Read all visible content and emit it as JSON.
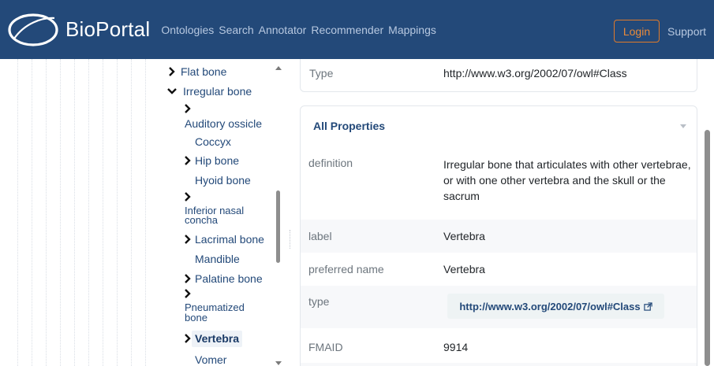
{
  "app": {
    "name": "BioPortal"
  },
  "nav": {
    "links": [
      "Ontologies",
      "Search",
      "Annotator",
      "Recommender",
      "Mappings"
    ],
    "login_label": "Login",
    "support_label": "Support"
  },
  "tree": {
    "nodes": [
      {
        "label": "Flat bone",
        "expandable": true,
        "expanded": false
      },
      {
        "label": "Irregular bone",
        "expandable": true,
        "expanded": true
      },
      {
        "label": "Auditory ossicle",
        "expandable": true,
        "expanded": false
      },
      {
        "label": "Coccyx",
        "expandable": false
      },
      {
        "label": "Hip bone",
        "expandable": true,
        "expanded": false
      },
      {
        "label": "Hyoid bone",
        "expandable": false
      },
      {
        "label": "Inferior nasal concha",
        "expandable": true,
        "expanded": false
      },
      {
        "label": "Lacrimal bone",
        "expandable": true,
        "expanded": false
      },
      {
        "label": "Mandible",
        "expandable": false
      },
      {
        "label": "Palatine bone",
        "expandable": true,
        "expanded": false
      },
      {
        "label": "Pneumatized bone",
        "expandable": true,
        "expanded": false
      },
      {
        "label": "Vertebra",
        "expandable": true,
        "expanded": false,
        "selected": true
      },
      {
        "label": "Vomer",
        "expandable": false
      }
    ]
  },
  "details": {
    "type_row": {
      "key": "Type",
      "value": "http://www.w3.org/2002/07/owl#Class"
    },
    "all_properties": {
      "title": "All Properties",
      "rows": [
        {
          "key": "definition",
          "value": "Irregular bone that articulates with other vertebrae, or with one other vertebra and the skull or the sacrum"
        },
        {
          "key": "label",
          "value": "Vertebra"
        },
        {
          "key": "preferred name",
          "value": "Vertebra"
        },
        {
          "key": "type",
          "value": "http://www.w3.org/2002/07/owl#Class"
        },
        {
          "key": "FMAID",
          "value": "9914"
        }
      ]
    }
  },
  "colors": {
    "navbar": "#234979",
    "link": "#234979",
    "login_accent": "#e07a2a"
  },
  "icons": [
    "bioportal-logo",
    "chevron-right-icon",
    "chevron-down-icon",
    "external-link-icon"
  ]
}
